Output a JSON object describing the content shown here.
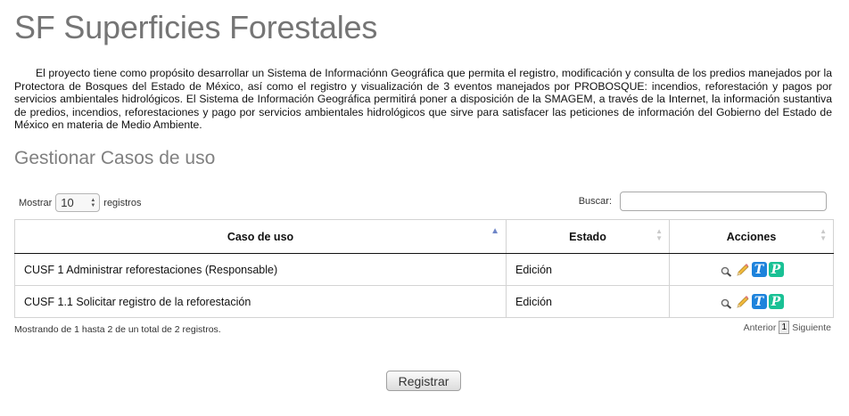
{
  "page": {
    "title": "SF Superficies Forestales",
    "intro": "El proyecto tiene como propósito desarrollar un Sistema de Informaciónn Geográfica que permita el registro, modificación y consulta de los predios manejados por la Protectora de Bosques del Estado de México, así como el registro y visualización de 3 eventos manejados por PROBOSQUE: incendios, reforestación y pagos por servicios ambientales hidrológicos. El Sistema de Información Geográfica permitirá poner a disposición de la SMAGEM, a través de la Internet, la información sustantiva de predios, incendios, reforestaciones y pago por servicios ambientales hidrológicos que sirve para satisfacer las peticiones de información del Gobierno del Estado de México en materia de Medio Ambiente.",
    "section_title": "Gestionar Casos de uso"
  },
  "controls": {
    "show_label": "Mostrar",
    "show_value": "10",
    "records_label": "registros",
    "search_label": "Buscar:",
    "search_value": ""
  },
  "table": {
    "columns": [
      "Caso de uso",
      "Estado",
      "Acciones"
    ],
    "rows": [
      {
        "case": "CUSF 1 Administrar reforestaciones (Responsable)",
        "status": "Edición"
      },
      {
        "case": "CUSF 1.1 Solicitar registro de la reforestación",
        "status": "Edición"
      }
    ]
  },
  "icons": {
    "view": "magnifier-icon",
    "edit": "pencil-icon",
    "t_letter": "T",
    "p_letter": "P"
  },
  "colors": {
    "t_icon": "#1e83dc",
    "p_icon": "#19c195",
    "sort_active": "#6f86c8"
  },
  "footer": {
    "info": "Mostrando de 1 hasta 2 de un total de 2 registros.",
    "prev": "Anterior",
    "current_page": "1",
    "next": "Siguiente",
    "register_button": "Registrar"
  }
}
